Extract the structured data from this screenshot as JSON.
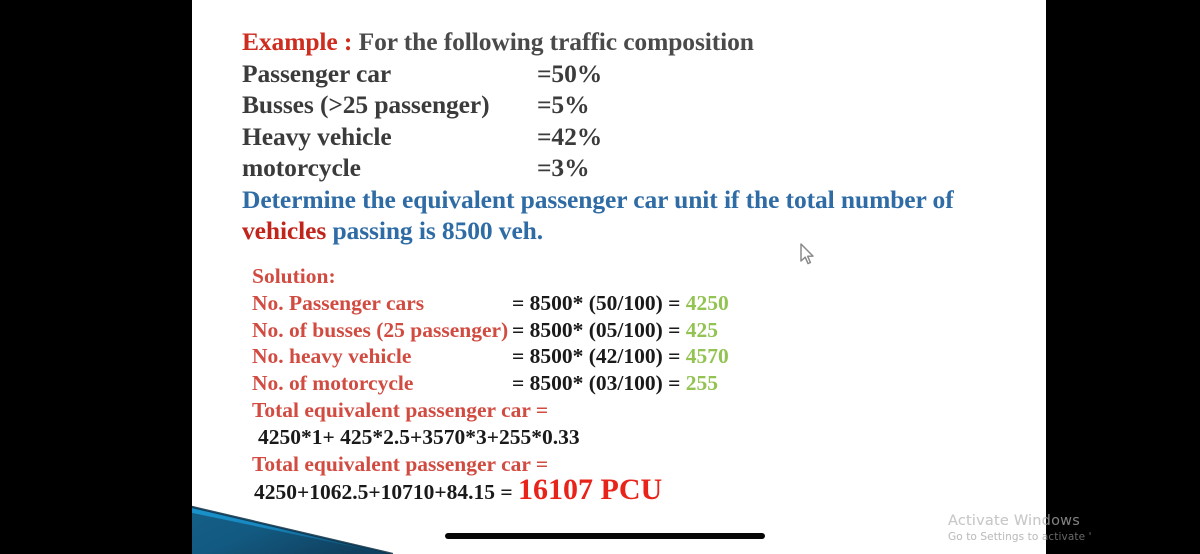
{
  "slide": {
    "problem": {
      "example_label": "Example :",
      "example_text": "For the following traffic composition",
      "rows": [
        {
          "label": "Passenger car",
          "value": "=50%"
        },
        {
          "label": "Busses (>25 passenger)",
          "value": "=5%"
        },
        {
          "label": "Heavy vehicle",
          "value": "=42%"
        },
        {
          "label": "motorcycle",
          "value": "=3%"
        }
      ],
      "determine_part1": "Determine the equivalent passenger car unit if the total number of",
      "determine_highlight": "vehicles",
      "determine_part2": " passing is 8500 veh."
    },
    "solution": {
      "heading": "Solution:",
      "lines": [
        {
          "label": "No. Passenger cars",
          "equation": "= 8500* (50/100) = ",
          "result": "4250"
        },
        {
          "label": "No. of busses (25 passenger)",
          "equation": "= 8500* (05/100) = ",
          "result": "425"
        },
        {
          "label": "No. heavy vehicle",
          "equation": "= 8500* (42/100) = ",
          "result": "4570"
        },
        {
          "label": "No. of motorcycle",
          "equation": "= 8500* (03/100) = ",
          "result": "255"
        }
      ],
      "total_label_1": "Total equivalent passenger car =",
      "sum_expression_1": "4250*1+ 425*2.5+3570*3+255*0.33",
      "total_label_2": "Total equivalent passenger car =",
      "sum_expression_2": "4250+1062.5+10710+84.15 = ",
      "final_answer": "16107 PCU"
    },
    "colors": {
      "red_title": "#cf2c20",
      "blue_text": "#2f6ca5",
      "red_label": "#d14b41",
      "green_result": "#93c353",
      "final_red": "#e8241a",
      "deco_blue": "#1b8cc4",
      "deco_navy": "#11354f"
    }
  },
  "overlay": {
    "activation_title": "Activate Windows",
    "activation_subtitle": "Go to Settings to activate '"
  }
}
